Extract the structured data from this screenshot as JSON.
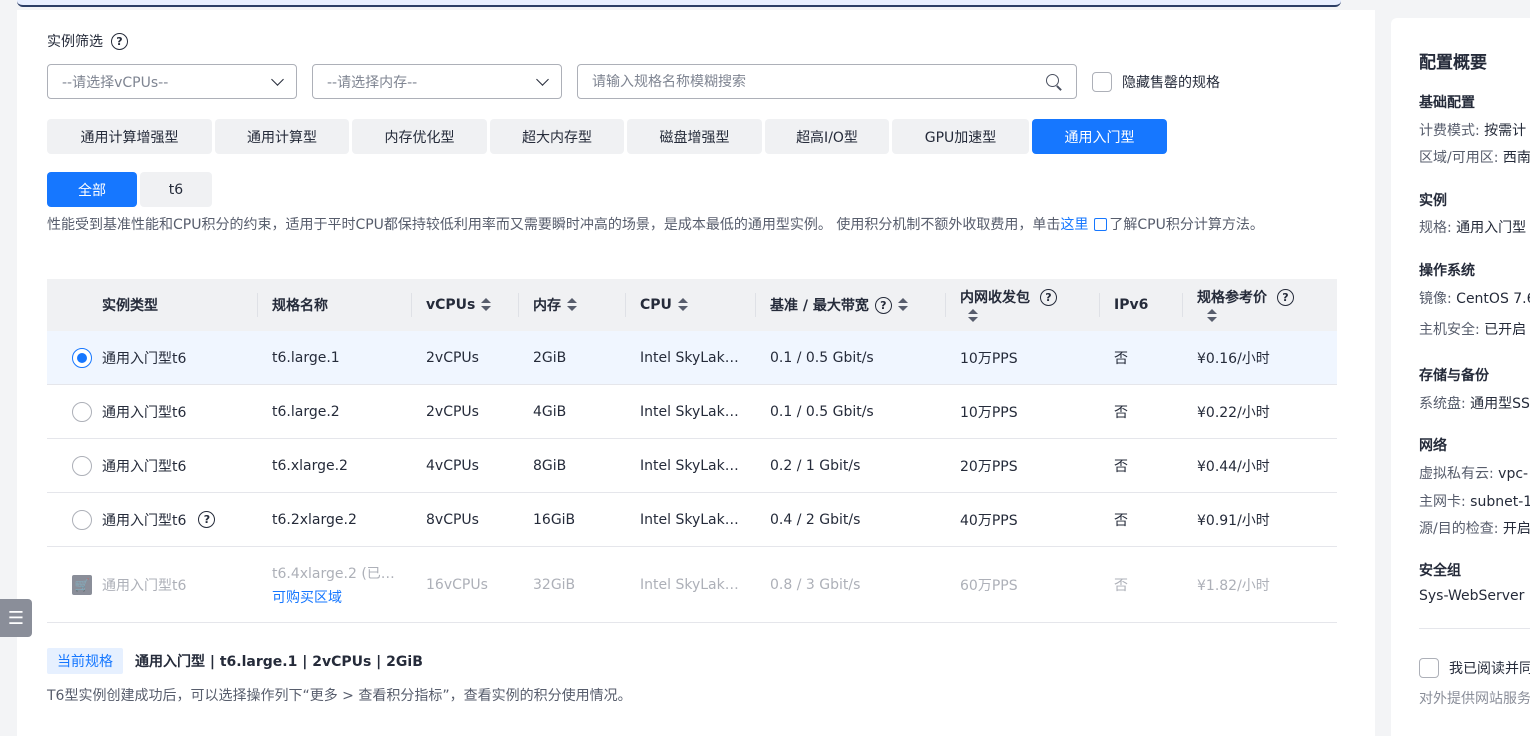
{
  "filter": {
    "label": "实例筛选",
    "vcpu_placeholder": "--请选择vCPUs--",
    "memory_placeholder": "--请选择内存--",
    "search_placeholder": "请输入规格名称模糊搜索",
    "hide_sold_out_label": "隐藏售罄的规格"
  },
  "family_tabs": [
    {
      "label": "通用计算增强型"
    },
    {
      "label": "通用计算型"
    },
    {
      "label": "内存优化型"
    },
    {
      "label": "超大内存型"
    },
    {
      "label": "磁盘增强型"
    },
    {
      "label": "超高I/O型"
    },
    {
      "label": "GPU加速型"
    },
    {
      "label": "通用入门型",
      "active": true
    }
  ],
  "sub_tabs": [
    {
      "label": "全部",
      "active": true
    },
    {
      "label": "t6"
    }
  ],
  "description": {
    "text": "性能受到基准性能和CPU积分的约束，适用于平时CPU都保持较低利用率而又需要瞬时冲高的场景，是成本最低的通用型实例。 使用积分机制不额外收取费用，单击",
    "link": "这里",
    "suffix": "了解CPU积分计算方法。"
  },
  "table": {
    "headers": {
      "type": "实例类型",
      "spec": "规格名称",
      "vcpus": "vCPUs",
      "memory": "内存",
      "cpu": "CPU",
      "bandwidth": "基准 / 最大带宽",
      "pps": "内网收发包",
      "ipv6": "IPv6",
      "price": "规格参考价"
    },
    "rows": [
      {
        "type": "通用入门型t6",
        "spec": "t6.large.1",
        "vcpus": "2vCPUs",
        "memory": "2GiB",
        "cpu": "Intel SkyLak…",
        "bandwidth": "0.1 / 0.5 Gbit/s",
        "pps": "10万PPS",
        "ipv6": "否",
        "price": "¥0.16/小时"
      },
      {
        "type": "通用入门型t6",
        "spec": "t6.large.2",
        "vcpus": "2vCPUs",
        "memory": "4GiB",
        "cpu": "Intel SkyLak…",
        "bandwidth": "0.1 / 0.5 Gbit/s",
        "pps": "10万PPS",
        "ipv6": "否",
        "price": "¥0.22/小时"
      },
      {
        "type": "通用入门型t6",
        "spec": "t6.xlarge.2",
        "vcpus": "4vCPUs",
        "memory": "8GiB",
        "cpu": "Intel SkyLak…",
        "bandwidth": "0.2 / 1 Gbit/s",
        "pps": "20万PPS",
        "ipv6": "否",
        "price": "¥0.44/小时"
      },
      {
        "type": "通用入门型t6",
        "spec": "t6.2xlarge.2",
        "vcpus": "8vCPUs",
        "memory": "16GiB",
        "cpu": "Intel SkyLak…",
        "bandwidth": "0.4 / 2 Gbit/s",
        "pps": "40万PPS",
        "ipv6": "否",
        "price": "¥0.91/小时"
      },
      {
        "type": "通用入门型t6",
        "spec": "t6.4xlarge.2 (已…",
        "spec_link": "可购买区域",
        "vcpus": "16vCPUs",
        "memory": "32GiB",
        "cpu": "Intel SkyLak…",
        "bandwidth": "0.8 / 3 Gbit/s",
        "pps": "60万PPS",
        "ipv6": "否",
        "price": "¥1.82/小时"
      }
    ]
  },
  "current_spec": {
    "badge": "当前规格",
    "value": "通用入门型 | t6.large.1 | 2vCPUs | 2GiB"
  },
  "note": "T6型实例创建成功后，可以选择操作列下“更多 > 查看积分指标”，查看实例的积分使用情况。",
  "summary": {
    "title": "配置概要",
    "basic": {
      "title": "基础配置",
      "billing_k": "计费模式: ",
      "billing_v": "按需计",
      "region_k": "区域/可用区: ",
      "region_v": "西南"
    },
    "instance": {
      "title": "实例",
      "spec_k": "规格: ",
      "spec_v": "通用入门型"
    },
    "os": {
      "title": "操作系统",
      "image_k": "镜像: ",
      "image_v": "CentOS 7.6",
      "security_k": "主机安全: ",
      "security_v": "已开启"
    },
    "storage": {
      "title": "存储与备份",
      "disk_k": "系统盘: ",
      "disk_v": "通用型SS"
    },
    "network": {
      "title": "网络",
      "vpc_k": "虚拟私有云: ",
      "vpc_v": "vpc-",
      "nic_k": "主网卡: ",
      "nic_v": "subnet-1",
      "check_k": "源/目的检查: ",
      "check_v": "开启"
    },
    "security_group": {
      "title": "安全组",
      "value": "Sys-WebServer"
    },
    "agree_label": "我已阅读并同",
    "agree_note": "对外提供网站服务"
  }
}
